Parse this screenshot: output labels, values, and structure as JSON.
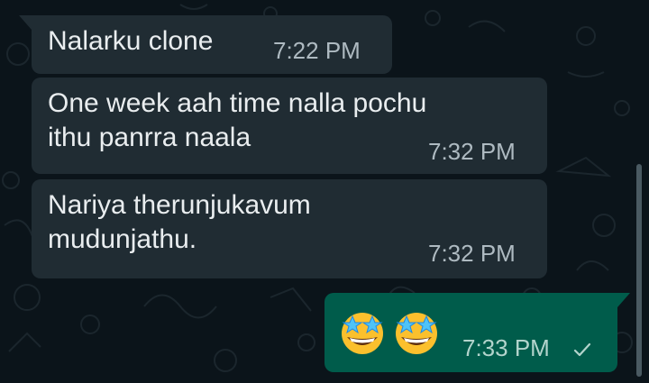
{
  "chat": {
    "messages": [
      {
        "direction": "incoming",
        "text": "Nalarku clone",
        "time": "7:22 PM"
      },
      {
        "direction": "incoming",
        "text": "One week aah time nalla pochu\nithu panrra naala",
        "time": "7:32 PM"
      },
      {
        "direction": "incoming",
        "text": "Nariya therunjukavum\nmudunjathu.",
        "time": "7:32 PM"
      },
      {
        "direction": "outgoing",
        "emojis": [
          "star-struck-emoji",
          "star-struck-emoji"
        ],
        "time": "7:33 PM",
        "status": "sent",
        "status_icon": "single-check-icon"
      }
    ]
  },
  "theme": {
    "background": "#0b141a",
    "incoming_bubble": "#202c33",
    "outgoing_bubble": "#005c4b",
    "text": "#e9edef",
    "timestamp": "#aebac1"
  }
}
